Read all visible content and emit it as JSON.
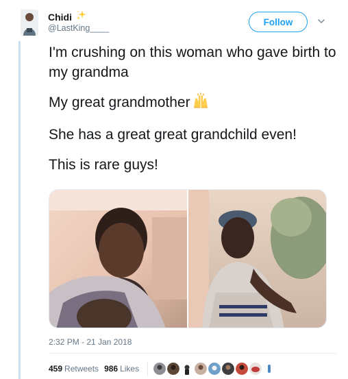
{
  "author": {
    "display_name": "Chidi",
    "handle": "@LastKing____"
  },
  "actions": {
    "follow_label": "Follow"
  },
  "tweet": {
    "paragraphs": [
      "I'm crushing on this woman who gave birth to my grandma",
      "My great grandmother",
      "She has a great great grandchild even!",
      "This is rare guys!"
    ]
  },
  "timestamp": "2:32 PM - 21 Jan 2018",
  "stats": {
    "retweets": "459",
    "retweets_label": "Retweets",
    "likes": "986",
    "likes_label": "Likes"
  },
  "icons": [
    "sparkles-icon",
    "chevron-down-icon",
    "raising-hands-icon"
  ],
  "colors": {
    "accent": "#1da1f2",
    "text": "#14171a",
    "muted": "#657786",
    "rule": "#cde0ef"
  }
}
